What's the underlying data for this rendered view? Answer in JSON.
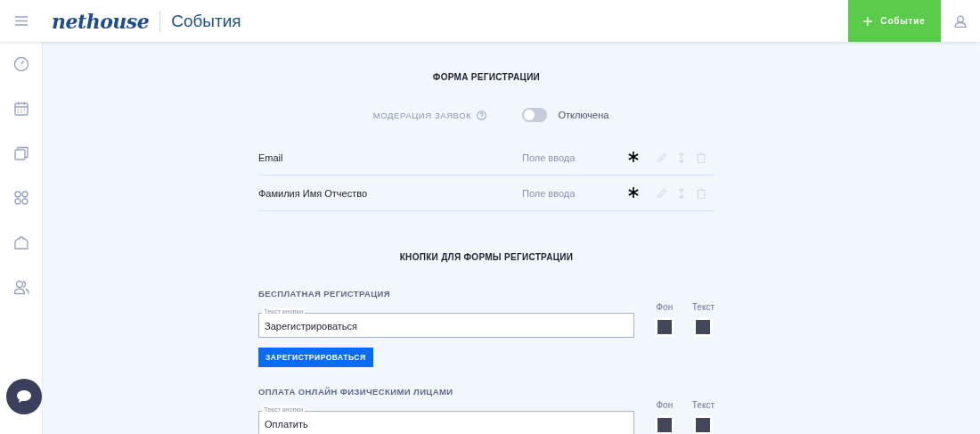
{
  "header": {
    "logo": "nethouse",
    "title": "События",
    "create_button": "Событие"
  },
  "sidebar": {
    "items": [
      {
        "kind": "dashboard"
      },
      {
        "kind": "calendar"
      },
      {
        "kind": "pages"
      },
      {
        "kind": "apps"
      },
      {
        "kind": "puzzle"
      },
      {
        "kind": "users"
      }
    ]
  },
  "form": {
    "title": "ФОРМА РЕГИСТРАЦИИ",
    "moderation": {
      "label": "МОДЕРАЦИЯ ЗАЯВОК",
      "on": false,
      "state_text": "Отключена"
    },
    "fields": [
      {
        "name": "Email",
        "type": "Поле ввода",
        "required": true
      },
      {
        "name": "Фамилия Имя Отчество",
        "type": "Поле ввода",
        "required": true
      }
    ]
  },
  "buttons_section": {
    "title": "КНОПКИ ДЛЯ ФОРМЫ РЕГИСТРАЦИИ",
    "groups": [
      {
        "title": "БЕСПЛАТНАЯ РЕГИСТРАЦИЯ",
        "field_label": "Текст кнопки",
        "value": "Зарегистрироваться",
        "preview": "ЗАРЕГИСТРИРОВАТЬСЯ",
        "swatches": [
          {
            "label": "Фон",
            "color": "#434559"
          },
          {
            "label": "Текст",
            "color": "#434559"
          }
        ]
      },
      {
        "title": "ОПЛАТА ОНЛАЙН ФИЗИЧЕСКИМИ ЛИЦАМИ",
        "field_label": "Текст кнопки",
        "value": "Оплатить",
        "swatches": [
          {
            "label": "Фон",
            "color": "#434559"
          },
          {
            "label": "Текст",
            "color": "#434559"
          }
        ]
      }
    ]
  }
}
